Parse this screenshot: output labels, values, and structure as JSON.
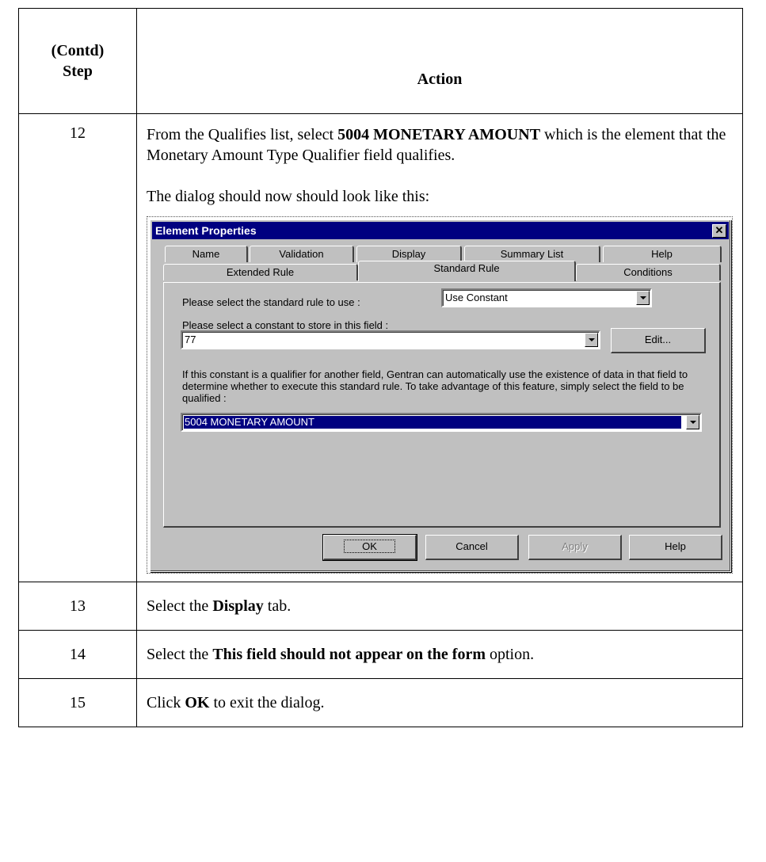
{
  "table": {
    "header": {
      "step_line1": "(Contd)",
      "step_line2": "Step",
      "action": "Action"
    },
    "rows": [
      {
        "step": "12",
        "text_pre": "From the Qualifies list, select ",
        "text_bold": "5004 MONETARY AMOUNT",
        "text_post": " which is the element that the Monetary Amount Type Qualifier field qualifies.",
        "followup": "The dialog should now should look like this:"
      },
      {
        "step": "13",
        "text_pre": "Select the ",
        "text_bold": "Display",
        "text_post": " tab."
      },
      {
        "step": "14",
        "text_pre": "Select the ",
        "text_bold": "This field should not appear on the form",
        "text_post": " option."
      },
      {
        "step": "15",
        "text_pre": "Click ",
        "text_bold": "OK",
        "text_post": " to exit the dialog."
      }
    ]
  },
  "dialog": {
    "title": "Element Properties",
    "close_glyph": "✕",
    "tabs_back": [
      "Name",
      "Validation",
      "Display",
      "Summary List",
      "Help"
    ],
    "tabs_front": [
      "Extended Rule",
      "Standard Rule",
      "Conditions"
    ],
    "active_tab": "Standard Rule",
    "rule_label": "Please select the standard rule to use :",
    "rule_value": "Use Constant",
    "constant_label": "Please select a constant to store in this field :",
    "constant_value": "77",
    "edit_button": "Edit...",
    "qualifier_text": "If this constant is a qualifier for another field, Gentran can automatically use the existence of data in that field to determine whether to execute this standard rule. To take advantage of this feature, simply select the field to be qualified :",
    "qualifies_value": "5004 MONETARY AMOUNT",
    "buttons": {
      "ok": "OK",
      "cancel": "Cancel",
      "apply": "Apply",
      "help": "Help"
    }
  }
}
